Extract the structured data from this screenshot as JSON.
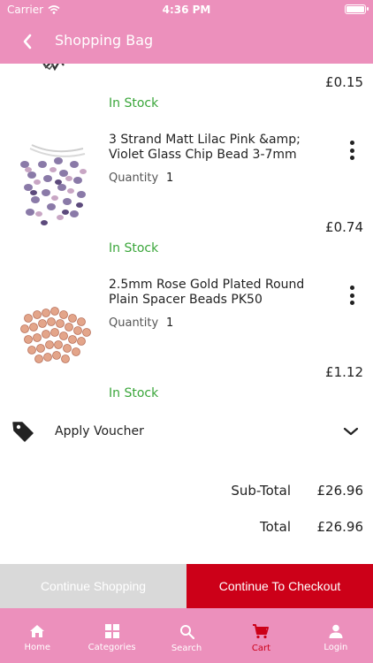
{
  "status_bar": {
    "carrier": "Carrier",
    "time": "4:36 PM"
  },
  "nav": {
    "title": "Shopping Bag"
  },
  "previous_item": {
    "price": "£0.15",
    "stock": "In Stock"
  },
  "items": [
    {
      "name": "3 Strand Matt Lilac Pink &amp; Violet Glass Chip Bead 3-7mm",
      "quantity_label": "Quantity",
      "quantity": "1",
      "price": "£0.74",
      "stock": "In Stock"
    },
    {
      "name": "2.5mm Rose Gold Plated Round Plain Spacer Beads PK50",
      "quantity_label": "Quantity",
      "quantity": "1",
      "price": "£1.12",
      "stock": "In Stock"
    }
  ],
  "voucher": {
    "label": "Apply Voucher"
  },
  "summary": {
    "subtotal_label": "Sub-Total",
    "subtotal_value": "£26.96",
    "total_label": "Total",
    "total_value": "£26.96"
  },
  "actions": {
    "continue_label": "Continue Shopping",
    "checkout_label": "Continue To Checkout"
  },
  "tabs": [
    {
      "label": "Home",
      "icon": "home-icon"
    },
    {
      "label": "Categories",
      "icon": "grid-icon"
    },
    {
      "label": "Search",
      "icon": "search-icon"
    },
    {
      "label": "Cart",
      "icon": "cart-icon",
      "active": true
    },
    {
      "label": "Login",
      "icon": "person-icon"
    }
  ],
  "colors": {
    "brand_pink": "#ec90bc",
    "checkout_red": "#cc0018",
    "stock_green": "#3aa63a",
    "muted_grey": "#d9d9d9"
  }
}
